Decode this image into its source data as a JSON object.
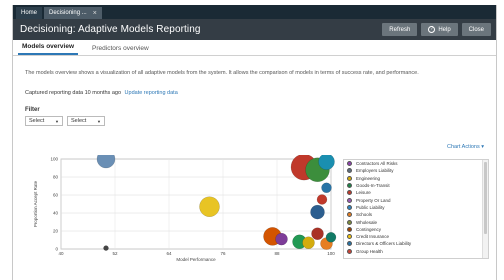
{
  "tabs": [
    {
      "label": "Home",
      "active": false
    },
    {
      "label": "Decisioning ...",
      "active": true,
      "close": "×"
    }
  ],
  "header": {
    "title": "Decisioning: Adaptive Models Reporting",
    "buttons": {
      "refresh": "Refresh",
      "help": "Help",
      "close": "Close"
    }
  },
  "subtabs": [
    {
      "label": "Models overview",
      "active": true
    },
    {
      "label": "Predictors overview",
      "active": false
    }
  ],
  "main": {
    "description": "The models overview shows a visualization of all adaptive models from the system. It allows the comparison of models in terms of success rate, and performance.",
    "captured_text": "Captured reporting data 10 months ago",
    "update_link": "Update reporting data",
    "filter_label": "Filter",
    "select1": "Select",
    "select2": "Select",
    "chart_actions": "Chart Actions"
  },
  "chart_data": {
    "type": "scatter",
    "xlabel": "Model Performance",
    "ylabel": "Proportion Accept Rate",
    "xlim": [
      40,
      100
    ],
    "ylim": [
      0,
      100
    ],
    "xticks": [
      40,
      52,
      64,
      76,
      88,
      100
    ],
    "yticks": [
      0,
      20,
      40,
      60,
      80,
      100
    ],
    "grid": true,
    "points": [
      {
        "x": 50,
        "y": 100,
        "r": 9,
        "color": "#6a8fb5"
      },
      {
        "x": 50,
        "y": 1,
        "r": 2.5,
        "color": "#444444"
      },
      {
        "x": 73,
        "y": 47,
        "r": 10,
        "color": "#e8c424"
      },
      {
        "x": 94,
        "y": 91,
        "r": 13,
        "color": "#c0392b"
      },
      {
        "x": 97,
        "y": 88,
        "r": 12,
        "color": "#3c8e3c"
      },
      {
        "x": 99,
        "y": 97,
        "r": 8,
        "color": "#1a8fb0"
      },
      {
        "x": 99,
        "y": 68,
        "r": 5,
        "color": "#2874a6"
      },
      {
        "x": 98,
        "y": 55,
        "r": 5,
        "color": "#c0392b"
      },
      {
        "x": 97,
        "y": 41,
        "r": 7,
        "color": "#2c5e8f"
      },
      {
        "x": 87,
        "y": 14,
        "r": 9,
        "color": "#d35400"
      },
      {
        "x": 89,
        "y": 11,
        "r": 6,
        "color": "#7d3c98"
      },
      {
        "x": 93,
        "y": 8,
        "r": 7,
        "color": "#229954"
      },
      {
        "x": 95,
        "y": 7,
        "r": 6,
        "color": "#d4ac0d"
      },
      {
        "x": 99,
        "y": 6,
        "r": 6,
        "color": "#e67e22"
      },
      {
        "x": 97,
        "y": 17,
        "r": 6,
        "color": "#a93226"
      },
      {
        "x": 100,
        "y": 13,
        "r": 5,
        "color": "#117a65"
      }
    ],
    "legend": [
      {
        "label": "Contractors All Risks",
        "color": "#8e44ad"
      },
      {
        "label": "Employers Liability",
        "color": "#5d6d7e"
      },
      {
        "label": "Engineering",
        "color": "#d4ac0d"
      },
      {
        "label": "Goods-In-Transit",
        "color": "#1e8449"
      },
      {
        "label": "Leisure",
        "color": "#c0392b"
      },
      {
        "label": "Property Or Land",
        "color": "#9b59b6"
      },
      {
        "label": "Public Liability",
        "color": "#2e86c1"
      },
      {
        "label": "Schools",
        "color": "#e67e22"
      },
      {
        "label": "Wholesale",
        "color": "#7d8c3c"
      },
      {
        "label": "Contingency",
        "color": "#a04000"
      },
      {
        "label": "Credit Insurance",
        "color": "#f1c40f"
      },
      {
        "label": "Directors & Officers Liability",
        "color": "#2874a6"
      },
      {
        "label": "Group Health",
        "color": "#cb4335"
      }
    ]
  }
}
